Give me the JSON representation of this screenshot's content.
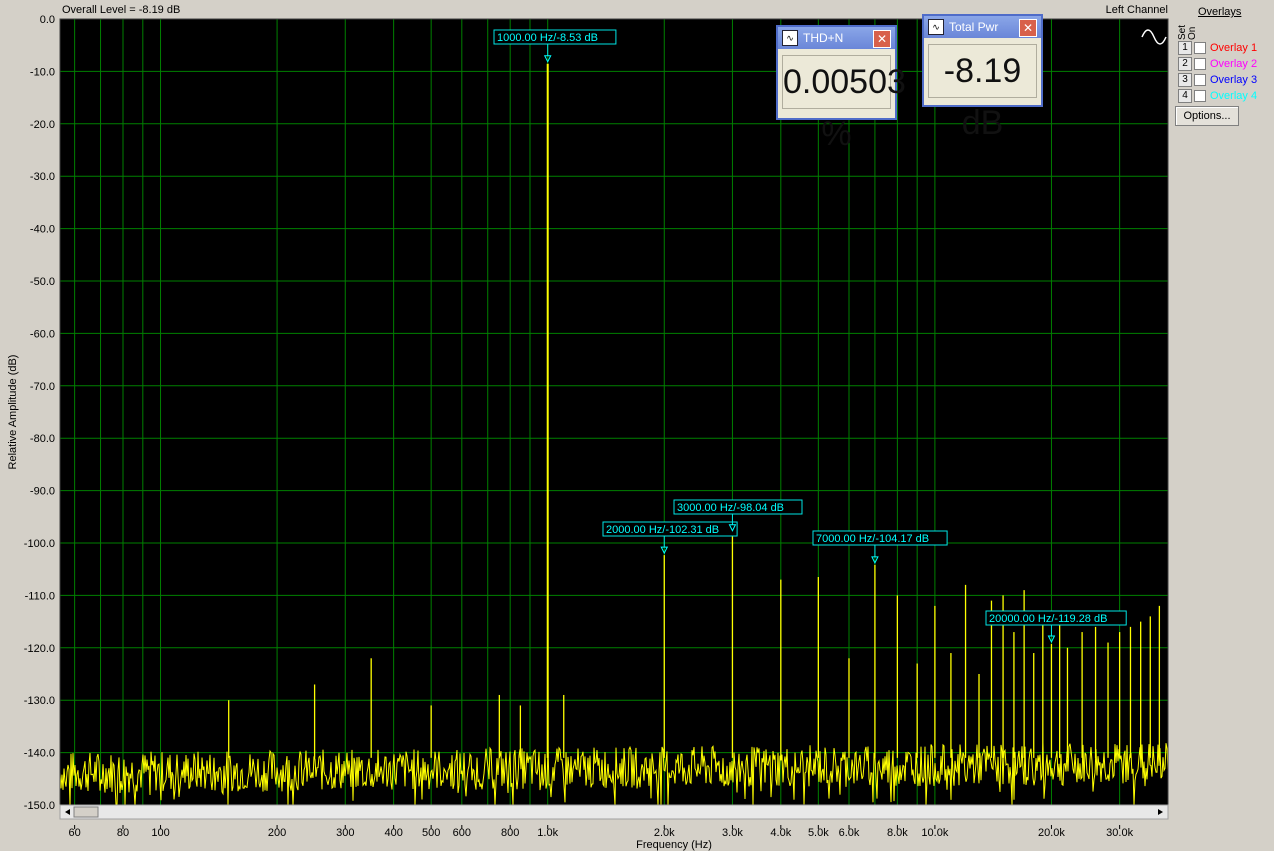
{
  "header": {
    "overall_level": "Overall Level = -8.19 dB",
    "channel": "Left Channel"
  },
  "overlays": {
    "title": "Overlays",
    "set_label": "Set",
    "on_label": "On",
    "items": [
      {
        "num": "1",
        "name": "Overlay 1",
        "color": "#ff0000"
      },
      {
        "num": "2",
        "name": "Overlay 2",
        "color": "#ff00ff"
      },
      {
        "num": "3",
        "name": "Overlay 3",
        "color": "#0000ff"
      },
      {
        "num": "4",
        "name": "Overlay 4",
        "color": "#00ffff"
      }
    ],
    "options_label": "Options..."
  },
  "meters": {
    "thdn": {
      "title": "THD+N",
      "value": "0.00503 %"
    },
    "total_pwr": {
      "title": "Total Pwr",
      "value": "-8.19 dB"
    }
  },
  "chart_data": {
    "type": "line",
    "xlabel": "Frequency (Hz)",
    "ylabel": "Relative Amplitude (dB)",
    "xscale": "log",
    "xlim": [
      55,
      40000
    ],
    "ylim": [
      -150,
      0
    ],
    "grid": true,
    "background": "#000000",
    "grid_color": "#008000",
    "trace_color": "#ffff00",
    "y_ticks": [
      "0.0",
      "-10.0",
      "-20.0",
      "-30.0",
      "-40.0",
      "-50.0",
      "-60.0",
      "-70.0",
      "-80.0",
      "-90.0",
      "-100.0",
      "-110.0",
      "-120.0",
      "-130.0",
      "-140.0",
      "-150.0"
    ],
    "x_ticks": [
      {
        "v": 60,
        "label": "60"
      },
      {
        "v": 80,
        "label": "80"
      },
      {
        "v": 100,
        "label": "100"
      },
      {
        "v": 200,
        "label": "200"
      },
      {
        "v": 300,
        "label": "300"
      },
      {
        "v": 400,
        "label": "400"
      },
      {
        "v": 500,
        "label": "500"
      },
      {
        "v": 600,
        "label": "600"
      },
      {
        "v": 800,
        "label": "800"
      },
      {
        "v": 1000,
        "label": "1.0k"
      },
      {
        "v": 2000,
        "label": "2.0k"
      },
      {
        "v": 3000,
        "label": "3.0k"
      },
      {
        "v": 4000,
        "label": "4.0k"
      },
      {
        "v": 5000,
        "label": "5.0k"
      },
      {
        "v": 6000,
        "label": "6.0k"
      },
      {
        "v": 8000,
        "label": "8.0k"
      },
      {
        "v": 10000,
        "label": "10.0k"
      },
      {
        "v": 20000,
        "label": "20.0k"
      },
      {
        "v": 30000,
        "label": "30.0k"
      }
    ],
    "noise_floor_db": -141,
    "peaks": [
      {
        "f": 1000,
        "db": -8.53
      },
      {
        "f": 2000,
        "db": -102.31
      },
      {
        "f": 3000,
        "db": -98.04
      },
      {
        "f": 4000,
        "db": -107
      },
      {
        "f": 5000,
        "db": -106.5
      },
      {
        "f": 6000,
        "db": -122
      },
      {
        "f": 7000,
        "db": -104.17
      },
      {
        "f": 8000,
        "db": -110
      },
      {
        "f": 9000,
        "db": -123
      },
      {
        "f": 10000,
        "db": -112
      },
      {
        "f": 11000,
        "db": -121
      },
      {
        "f": 12000,
        "db": -108
      },
      {
        "f": 13000,
        "db": -125
      },
      {
        "f": 14000,
        "db": -111
      },
      {
        "f": 15000,
        "db": -110
      },
      {
        "f": 16000,
        "db": -117
      },
      {
        "f": 17000,
        "db": -109
      },
      {
        "f": 18000,
        "db": -121
      },
      {
        "f": 19000,
        "db": -113
      },
      {
        "f": 20000,
        "db": -119.28
      },
      {
        "f": 21000,
        "db": -115
      },
      {
        "f": 22000,
        "db": -120
      },
      {
        "f": 24000,
        "db": -117
      },
      {
        "f": 26000,
        "db": -116
      },
      {
        "f": 28000,
        "db": -119
      },
      {
        "f": 30000,
        "db": -117
      },
      {
        "f": 32000,
        "db": -116
      },
      {
        "f": 34000,
        "db": -115
      },
      {
        "f": 36000,
        "db": -114
      },
      {
        "f": 38000,
        "db": -112
      },
      {
        "f": 250,
        "db": -127
      },
      {
        "f": 350,
        "db": -122
      },
      {
        "f": 150,
        "db": -130
      },
      {
        "f": 500,
        "db": -131
      },
      {
        "f": 750,
        "db": -129
      },
      {
        "f": 850,
        "db": -131
      },
      {
        "f": 1100,
        "db": -129
      }
    ],
    "markers": [
      {
        "f": 1000,
        "db": -8.53,
        "label": "1000.00 Hz/-8.53 dB"
      },
      {
        "f": 2000,
        "db": -102.31,
        "label": "2000.00 Hz/-102.31 dB"
      },
      {
        "f": 3000,
        "db": -98.04,
        "label": "3000.00 Hz/-98.04 dB"
      },
      {
        "f": 7000,
        "db": -104.17,
        "label": "7000.00 Hz/-104.17 dB"
      },
      {
        "f": 20000,
        "db": -119.28,
        "label": "20000.00 Hz/-119.28 dB"
      }
    ]
  }
}
